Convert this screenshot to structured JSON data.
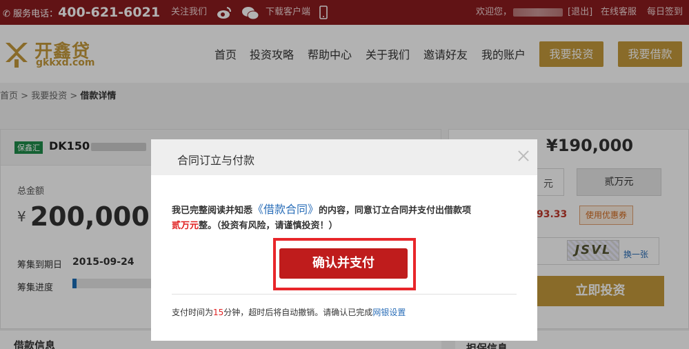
{
  "topbar": {
    "phone_label": "服务电话：",
    "phone_number": "400-621-6021",
    "follow": "关注我们",
    "download": "下载客户端",
    "welcome": "欢迎您，",
    "logout": "[退出]",
    "online_service": "在线客服",
    "checkin": "每日签到"
  },
  "header": {
    "logo_cn": "开鑫贷",
    "logo_en": "gkkxd.com",
    "nav": [
      "首页",
      "投资攻略",
      "帮助中心",
      "关于我们",
      "邀请好友",
      "我的账户"
    ],
    "btn_invest": "我要投资",
    "btn_borrow": "我要借款"
  },
  "breadcrumb": {
    "home": "首页",
    "sep": " > ",
    "invest": "我要投资",
    "current": "借款详情"
  },
  "loan": {
    "badge": "保鑫汇",
    "code": "DK150",
    "total_label": "总金额",
    "currency": "¥",
    "total_amount": "200,000",
    "due_label": "筹集到期日",
    "due_date": "2015-09-24",
    "progress_label": "筹集进度",
    "progress_fraction": 0.05,
    "section_title": "借款信息"
  },
  "invest_panel": {
    "available": "¥190,000",
    "unit": "元",
    "amount_upper": "贰万元",
    "benefit_value": "93.33",
    "coupon": "使用优惠券",
    "captcha_text": "JSVL",
    "captcha_change": "换一张",
    "invest_now": "立即投资",
    "section_title": "担保信息"
  },
  "modal": {
    "title": "合同订立与付款",
    "msg_prefix": "我已完整阅读并知悉",
    "contract_link": "《借款合同》",
    "msg_suffix": "的内容，同意订立合同并支付出借款项",
    "amount": "贰万元",
    "msg_end": "整。（投资有风险，请谨慎投资！）",
    "confirm_button": "确认并支付",
    "footnote_prefix": "支付时间为",
    "footnote_minutes": "15",
    "footnote_mid": "分钟，超时后将自动撤销。请确认已完成",
    "footnote_link": "网银设置"
  }
}
